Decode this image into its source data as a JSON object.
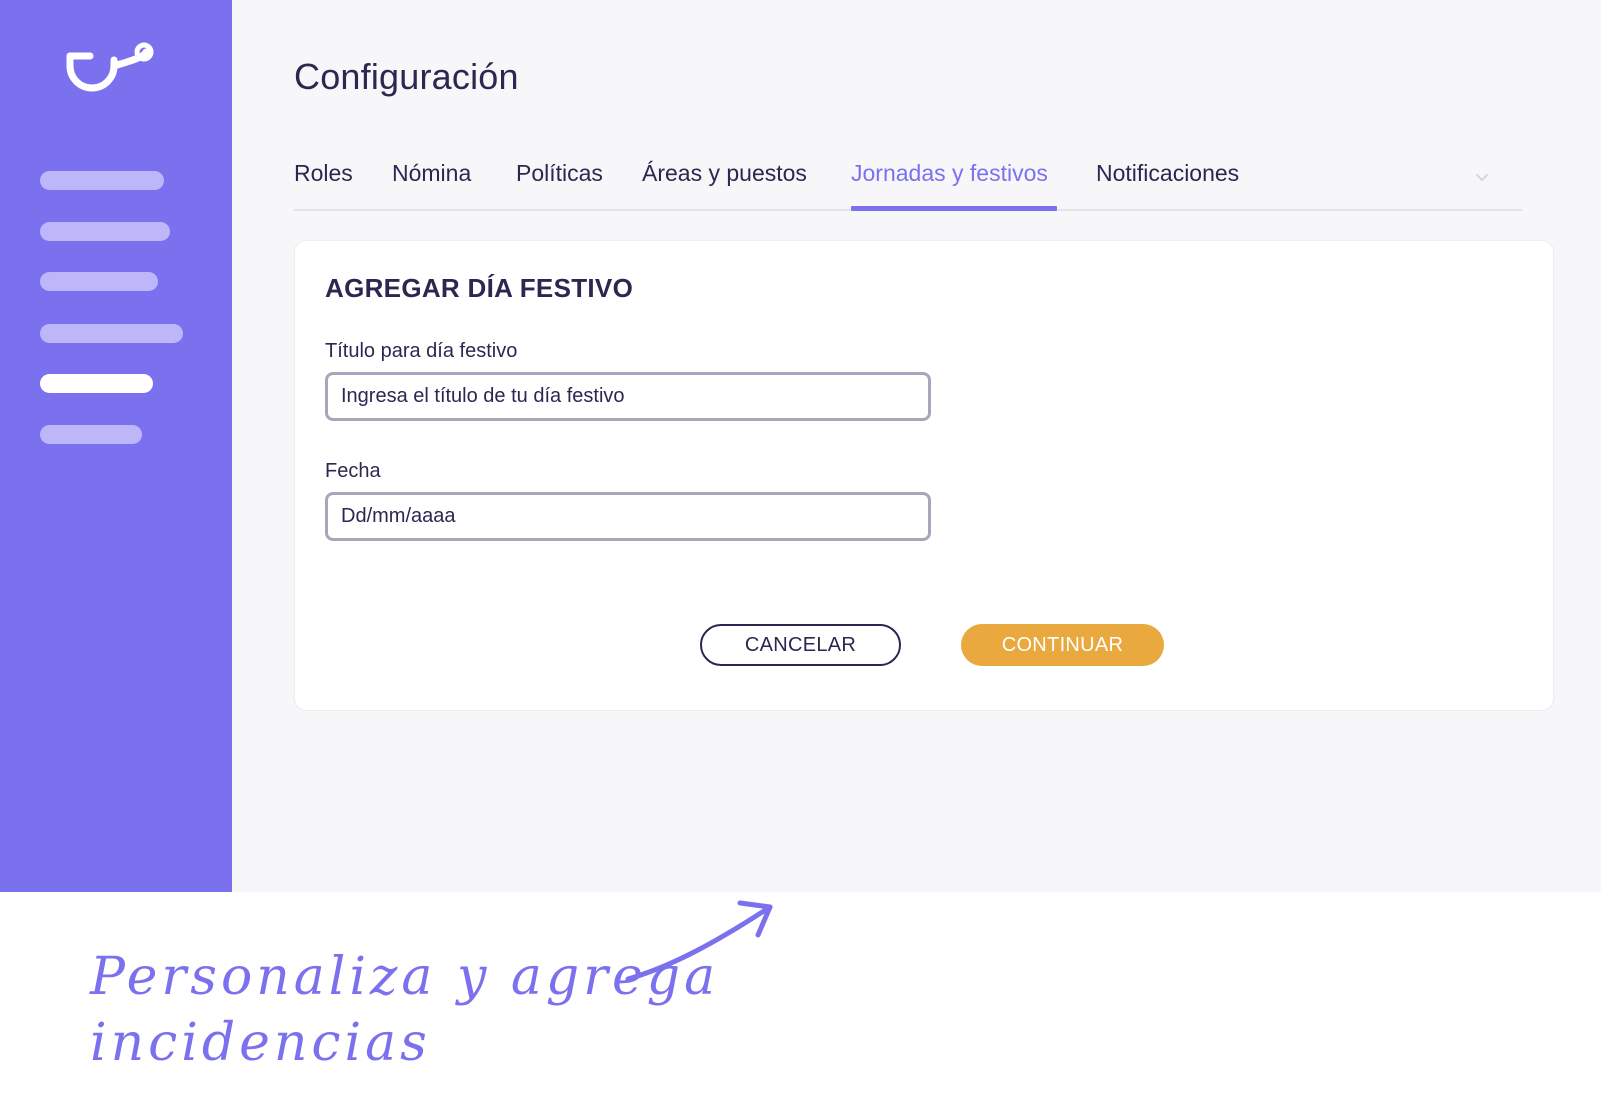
{
  "colors": {
    "sidebar": "#7b71ef",
    "accent": "#7b71ef",
    "nav_inactive": "#bdb7fa",
    "nav_active": "#ffffff",
    "primary_button": "#e9a93f",
    "text": "#2e2650"
  },
  "sidebar": {
    "logo": "app-logo-icon",
    "items": [
      {
        "name": "nav-item-1",
        "active": false
      },
      {
        "name": "nav-item-2",
        "active": false
      },
      {
        "name": "nav-item-3",
        "active": false
      },
      {
        "name": "nav-item-4",
        "active": false
      },
      {
        "name": "nav-item-5",
        "active": true
      },
      {
        "name": "nav-item-6",
        "active": false
      }
    ]
  },
  "header": {
    "title": "Configuración"
  },
  "tabs": [
    {
      "label": "Roles",
      "active": false
    },
    {
      "label": "Nómina",
      "active": false
    },
    {
      "label": "Políticas",
      "active": false
    },
    {
      "label": "Áreas y puestos",
      "active": false
    },
    {
      "label": "Jornadas y festivos",
      "active": true
    },
    {
      "label": "Notificaciones",
      "active": false
    }
  ],
  "tabs_overflow_icon": "chevron-down-icon",
  "form": {
    "title": "AGREGAR DÍA FESTIVO",
    "holiday_title": {
      "label": "Título para día festivo",
      "placeholder": "Ingresa el título de tu día festivo",
      "value": ""
    },
    "date": {
      "label": "Fecha",
      "placeholder": "Dd/mm/aaaa",
      "value": ""
    },
    "cancel_label": "CANCELAR",
    "continue_label": "CONTINUAR"
  },
  "annotation": {
    "line1": "Personaliza y agrega",
    "line2": "incidencias",
    "icon": "arrow-icon"
  }
}
